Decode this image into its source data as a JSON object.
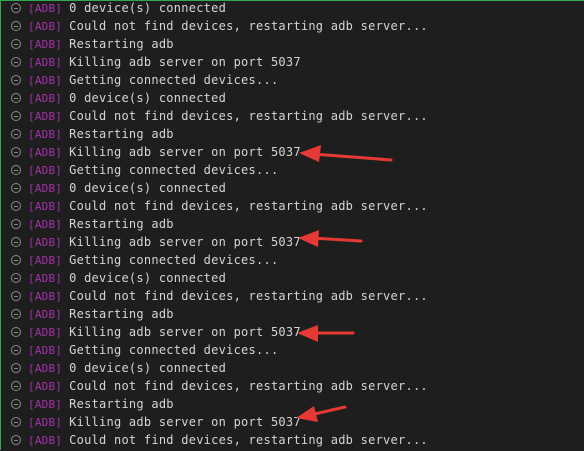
{
  "accent_border_color": "#2fa84f",
  "tag_color": "#a333a8",
  "text_color": "#d4d4d4",
  "annotation_arrow_color": "#e53935",
  "line_icon": "minus-circle-icon",
  "log": {
    "tag": "[ADB]",
    "lines": [
      "0 device(s) connected",
      "Could not find devices, restarting adb server...",
      "Restarting adb",
      "Killing adb server on port 5037",
      "Getting connected devices...",
      "0 device(s) connected",
      "Could not find devices, restarting adb server...",
      "Restarting adb",
      "Killing adb server on port 5037",
      "Getting connected devices...",
      "0 device(s) connected",
      "Could not find devices, restarting adb server...",
      "Restarting adb",
      "Killing adb server on port 5037",
      "Getting connected devices...",
      "0 device(s) connected",
      "Could not find devices, restarting adb server...",
      "Restarting adb",
      "Killing adb server on port 5037",
      "Getting connected devices...",
      "0 device(s) connected",
      "Could not find devices, restarting adb server...",
      "Restarting adb",
      "Killing adb server on port 5037",
      "Could not find devices, restarting adb server..."
    ]
  }
}
